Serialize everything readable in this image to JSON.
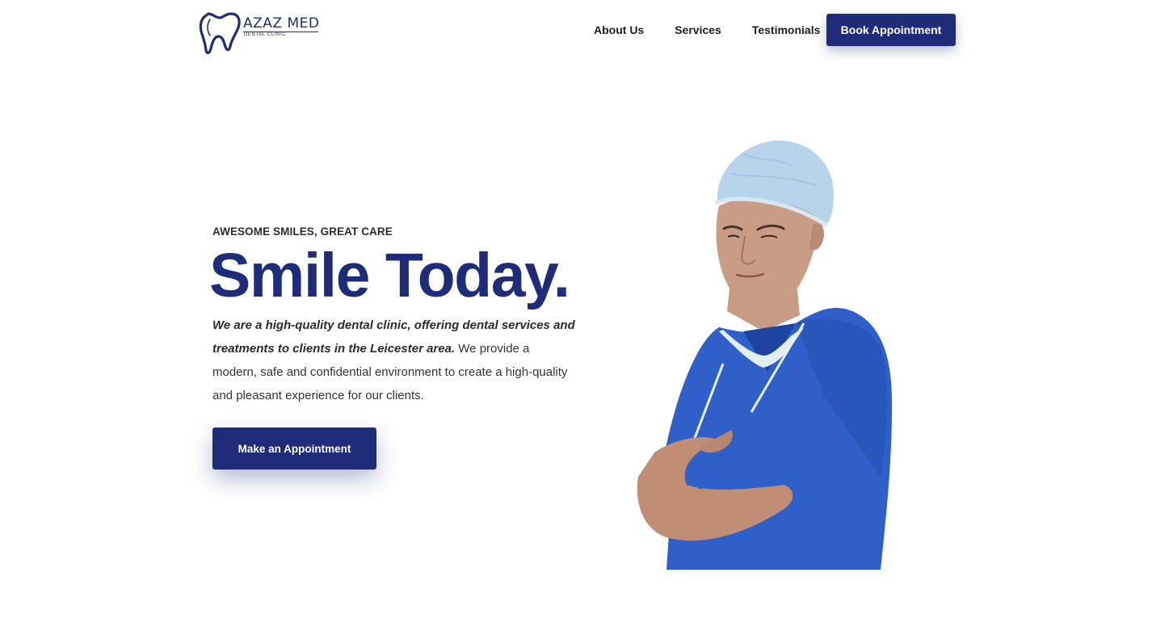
{
  "header": {
    "logo": {
      "name": "AZAZ MED",
      "subtitle": "DENTAL CLINIC"
    },
    "nav": [
      {
        "label": "About Us"
      },
      {
        "label": "Services"
      },
      {
        "label": "Testimonials"
      }
    ],
    "book_button": "Book Appointment"
  },
  "hero": {
    "eyebrow": "AWESOME SMILES, GREAT CARE",
    "title": "Smile Today.",
    "description_emphasis": "We are a high-quality dental clinic, offering dental services and treatments to clients in the Leicester area.",
    "description_rest": " We provide a modern, safe and confidential environment to create a high-quality and pleasant experience for our clients.",
    "cta": "Make an Appointment"
  },
  "colors": {
    "brand": "#1f2c7a",
    "scrubs": "#2f5fc8",
    "background": "#ffffff"
  },
  "icons": {
    "logo": "tooth-outline-icon"
  }
}
